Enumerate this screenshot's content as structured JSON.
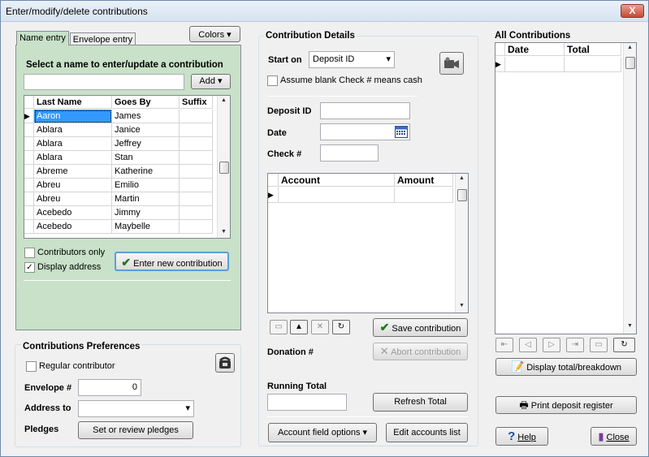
{
  "window": {
    "title": "Enter/modify/delete contributions",
    "close_label": "X"
  },
  "left": {
    "tabs": [
      {
        "label": "Name entry"
      },
      {
        "label": "Envelope entry"
      }
    ],
    "colors_label": "Colors",
    "select_prompt": "Select a name to enter/update a contribution",
    "search_value": "",
    "add_label": "Add",
    "columns": [
      "Last Name",
      "Goes By",
      "Suffix"
    ],
    "rows": [
      {
        "last": "Aaron",
        "goes": "James",
        "suffix": ""
      },
      {
        "last": "Ablara",
        "goes": "Janice",
        "suffix": ""
      },
      {
        "last": "Ablara",
        "goes": "Jeffrey",
        "suffix": ""
      },
      {
        "last": "Ablara",
        "goes": "Stan",
        "suffix": ""
      },
      {
        "last": "Abreme",
        "goes": "Katherine",
        "suffix": ""
      },
      {
        "last": "Abreu",
        "goes": "Emilio",
        "suffix": ""
      },
      {
        "last": "Abreu",
        "goes": "Martin",
        "suffix": ""
      },
      {
        "last": "Acebedo",
        "goes": "Jimmy",
        "suffix": ""
      },
      {
        "last": "Acebedo",
        "goes": "Maybelle",
        "suffix": ""
      }
    ],
    "contributors_only": {
      "label": "Contributors only",
      "checked": false
    },
    "display_address": {
      "label": "Display address",
      "checked": true
    },
    "enter_new_label": "Enter new contribution"
  },
  "prefs": {
    "title": "Contributions Preferences",
    "regular": {
      "label": "Regular contributor",
      "checked": false
    },
    "envelope_label": "Envelope #",
    "envelope_value": "0",
    "address_label": "Address to",
    "address_value": "",
    "pledges_label": "Pledges",
    "pledges_button": "Set or review pledges"
  },
  "details": {
    "title": "Contribution Details",
    "start_on_label": "Start on",
    "start_on_value": "Deposit ID",
    "assume_blank": {
      "label": "Assume blank Check # means cash",
      "checked": false
    },
    "deposit_label": "Deposit ID",
    "deposit_value": "",
    "date_label": "Date",
    "date_value": "",
    "check_label": "Check #",
    "check_value": "",
    "columns": [
      "Account",
      "Amount"
    ],
    "save_label": "Save contribution",
    "abort_label": "Abort contribution",
    "donation_label": "Donation #",
    "running_total_label": "Running Total",
    "running_total_value": "",
    "refresh_label": "Refresh Total",
    "account_options_label": "Account field options",
    "edit_accounts_label": "Edit accounts list"
  },
  "all": {
    "title": "All Contributions",
    "columns": [
      "Date",
      "Total"
    ],
    "display_total_label": "Display total/breakdown",
    "print_label": "Print deposit register",
    "help_label": "Help",
    "close_label": "Close"
  },
  "colors": {
    "accent_green": "#c8e1c8",
    "selection": "#3399ff"
  }
}
